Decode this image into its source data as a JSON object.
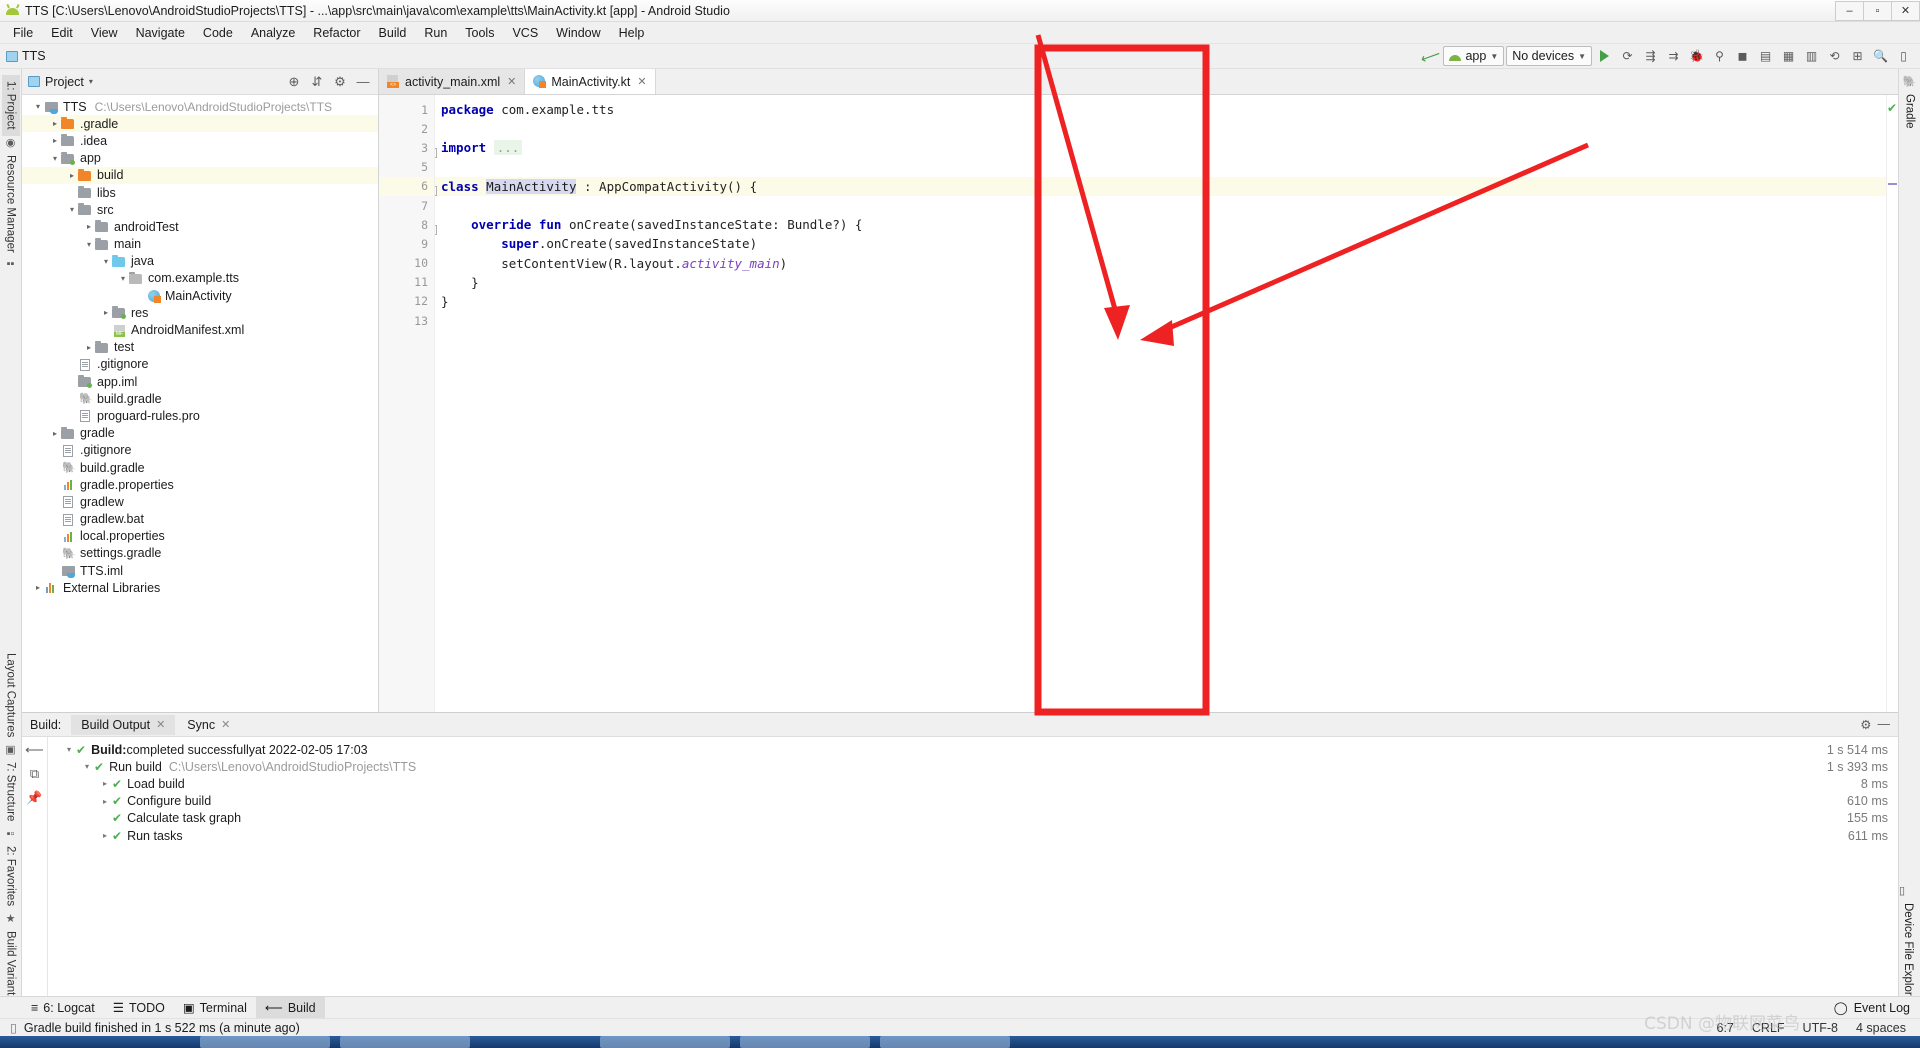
{
  "window": {
    "title": "TTS [C:\\Users\\Lenovo\\AndroidStudioProjects\\TTS] - ...\\app\\src\\main\\java\\com\\example\\tts\\MainActivity.kt [app] - Android Studio",
    "minimize": "–",
    "maximize": "▫",
    "close": "✕"
  },
  "menu": [
    "File",
    "Edit",
    "View",
    "Navigate",
    "Code",
    "Analyze",
    "Refactor",
    "Build",
    "Run",
    "Tools",
    "VCS",
    "Window",
    "Help"
  ],
  "navbar": {
    "breadcrumb": "TTS",
    "run_config": "app",
    "device": "No devices"
  },
  "project_panel": {
    "title": "Project",
    "caret": "▾",
    "tree": [
      {
        "depth": 0,
        "arrow": "▾",
        "icon": "module",
        "label": "TTS",
        "path": "C:\\Users\\Lenovo\\AndroidStudioProjects\\TTS",
        "hl": false
      },
      {
        "depth": 1,
        "arrow": "▸",
        "icon": "folder-orange",
        "label": ".gradle",
        "path": "",
        "hl": true
      },
      {
        "depth": 1,
        "arrow": "▸",
        "icon": "folder",
        "label": ".idea",
        "path": "",
        "hl": false
      },
      {
        "depth": 1,
        "arrow": "▾",
        "icon": "folder-dot",
        "label": "app",
        "path": "",
        "hl": false
      },
      {
        "depth": 2,
        "arrow": "▸",
        "icon": "folder-orange",
        "label": "build",
        "path": "",
        "hl": true
      },
      {
        "depth": 2,
        "arrow": "",
        "icon": "folder",
        "label": "libs",
        "path": "",
        "hl": false
      },
      {
        "depth": 2,
        "arrow": "▾",
        "icon": "folder",
        "label": "src",
        "path": "",
        "hl": false
      },
      {
        "depth": 3,
        "arrow": "▸",
        "icon": "folder",
        "label": "androidTest",
        "path": "",
        "hl": false
      },
      {
        "depth": 3,
        "arrow": "▾",
        "icon": "folder",
        "label": "main",
        "path": "",
        "hl": false
      },
      {
        "depth": 4,
        "arrow": "▾",
        "icon": "folder-blue",
        "label": "java",
        "path": "",
        "hl": false
      },
      {
        "depth": 5,
        "arrow": "▾",
        "icon": "package",
        "label": "com.example.tts",
        "path": "",
        "hl": false
      },
      {
        "depth": 6,
        "arrow": "",
        "icon": "kotlin",
        "label": "MainActivity",
        "path": "",
        "hl": false
      },
      {
        "depth": 4,
        "arrow": "▸",
        "icon": "folder-res",
        "label": "res",
        "path": "",
        "hl": false
      },
      {
        "depth": 4,
        "arrow": "",
        "icon": "manifest",
        "label": "AndroidManifest.xml",
        "path": "",
        "hl": false
      },
      {
        "depth": 3,
        "arrow": "▸",
        "icon": "folder",
        "label": "test",
        "path": "",
        "hl": false
      },
      {
        "depth": 2,
        "arrow": "",
        "icon": "file",
        "label": ".gitignore",
        "path": "",
        "hl": false
      },
      {
        "depth": 2,
        "arrow": "",
        "icon": "folder-dot",
        "label": "app.iml",
        "path": "",
        "hl": false
      },
      {
        "depth": 2,
        "arrow": "",
        "icon": "gradle",
        "label": "build.gradle",
        "path": "",
        "hl": false
      },
      {
        "depth": 2,
        "arrow": "",
        "icon": "file",
        "label": "proguard-rules.pro",
        "path": "",
        "hl": false
      },
      {
        "depth": 1,
        "arrow": "▸",
        "icon": "folder",
        "label": "gradle",
        "path": "",
        "hl": false
      },
      {
        "depth": 1,
        "arrow": "",
        "icon": "file",
        "label": ".gitignore",
        "path": "",
        "hl": false
      },
      {
        "depth": 1,
        "arrow": "",
        "icon": "gradle",
        "label": "build.gradle",
        "path": "",
        "hl": false
      },
      {
        "depth": 1,
        "arrow": "",
        "icon": "props",
        "label": "gradle.properties",
        "path": "",
        "hl": false
      },
      {
        "depth": 1,
        "arrow": "",
        "icon": "file",
        "label": "gradlew",
        "path": "",
        "hl": false
      },
      {
        "depth": 1,
        "arrow": "",
        "icon": "file",
        "label": "gradlew.bat",
        "path": "",
        "hl": false
      },
      {
        "depth": 1,
        "arrow": "",
        "icon": "props",
        "label": "local.properties",
        "path": "",
        "hl": false
      },
      {
        "depth": 1,
        "arrow": "",
        "icon": "gradle",
        "label": "settings.gradle",
        "path": "",
        "hl": false
      },
      {
        "depth": 1,
        "arrow": "",
        "icon": "iml",
        "label": "TTS.iml",
        "path": "",
        "hl": false
      },
      {
        "depth": 0,
        "arrow": "▸",
        "icon": "library",
        "label": "External Libraries",
        "path": "",
        "hl": false
      }
    ]
  },
  "left_rail": {
    "top": [
      "1: Project",
      "Resource Manager"
    ],
    "bottom": [
      "Layout Captures",
      "7: Structure",
      "2: Favorites",
      "Build Variants"
    ]
  },
  "right_rail": {
    "top": "Gradle",
    "bottom": "Device File Explorer"
  },
  "editor": {
    "tabs": [
      {
        "label": "activity_main.xml",
        "icon": "xml-file-icon",
        "active": false,
        "close": "✕"
      },
      {
        "label": "MainActivity.kt",
        "icon": "kotlin-file-icon",
        "active": true,
        "close": "✕"
      }
    ],
    "line_numbers": [
      "1",
      "2",
      "3",
      "5",
      "6",
      "7",
      "8",
      "9",
      "10",
      "11",
      "12",
      "13"
    ],
    "code_lines": [
      {
        "num": "1",
        "hl": false,
        "tokens": [
          {
            "t": "package",
            "c": "kw"
          },
          {
            "t": " com.example.tts",
            "c": "pl"
          }
        ]
      },
      {
        "num": "2",
        "hl": false,
        "tokens": []
      },
      {
        "num": "3",
        "hl": false,
        "fold": "+",
        "tokens": [
          {
            "t": "import",
            "c": "kw"
          },
          {
            "t": " ",
            "c": "pl"
          },
          {
            "t": "...",
            "c": "importbox"
          }
        ]
      },
      {
        "num": "5",
        "hl": false,
        "tokens": []
      },
      {
        "num": "6",
        "hl": true,
        "fold": "−",
        "tokens": [
          {
            "t": "class",
            "c": "kw"
          },
          {
            "t": " ",
            "c": "pl"
          },
          {
            "t": "MainActivity",
            "c": "sel"
          },
          {
            "t": " : AppCompatActivity() {",
            "c": "pl"
          }
        ]
      },
      {
        "num": "7",
        "hl": false,
        "tokens": []
      },
      {
        "num": "8",
        "hl": false,
        "fold": "−",
        "tokens": [
          {
            "t": "    ",
            "c": "pl"
          },
          {
            "t": "override fun",
            "c": "kw"
          },
          {
            "t": " onCreate(savedInstanceState: Bundle?) {",
            "c": "pl"
          }
        ]
      },
      {
        "num": "9",
        "hl": false,
        "tokens": [
          {
            "t": "        ",
            "c": "pl"
          },
          {
            "t": "super",
            "c": "kw"
          },
          {
            "t": ".onCreate(savedInstanceState)",
            "c": "pl"
          }
        ]
      },
      {
        "num": "10",
        "hl": false,
        "tokens": [
          {
            "t": "        setContentView(R.layout.",
            "c": "pl"
          },
          {
            "t": "activity_main",
            "c": "prop"
          },
          {
            "t": ")",
            "c": "pl"
          }
        ]
      },
      {
        "num": "11",
        "hl": false,
        "tokens": [
          {
            "t": "    }",
            "c": "pl"
          }
        ]
      },
      {
        "num": "12",
        "hl": false,
        "tokens": [
          {
            "t": "}",
            "c": "pl"
          }
        ]
      },
      {
        "num": "13",
        "hl": false,
        "tokens": []
      }
    ]
  },
  "build_panel": {
    "label": "Build:",
    "tabs": [
      {
        "label": "Build Output",
        "active": true,
        "close": "✕"
      },
      {
        "label": "Sync",
        "active": false,
        "close": "✕"
      }
    ],
    "rows": [
      {
        "depth": 0,
        "arrow": "▾",
        "bold": "Build:",
        "text": " completed successfully",
        "suffix": " at 2022-02-05 17:03",
        "path": "",
        "time": "1 s 514 ms"
      },
      {
        "depth": 1,
        "arrow": "▾",
        "bold": "",
        "text": "Run build",
        "suffix": "",
        "path": "C:\\Users\\Lenovo\\AndroidStudioProjects\\TTS",
        "time": "1 s 393 ms"
      },
      {
        "depth": 2,
        "arrow": "▸",
        "bold": "",
        "text": "Load build",
        "suffix": "",
        "path": "",
        "time": "8 ms"
      },
      {
        "depth": 2,
        "arrow": "▸",
        "bold": "",
        "text": "Configure build",
        "suffix": "",
        "path": "",
        "time": "610 ms"
      },
      {
        "depth": 2,
        "arrow": "",
        "bold": "",
        "text": "Calculate task graph",
        "suffix": "",
        "path": "",
        "time": "155 ms"
      },
      {
        "depth": 2,
        "arrow": "▸",
        "bold": "",
        "text": "Run tasks",
        "suffix": "",
        "path": "",
        "time": "611 ms"
      }
    ]
  },
  "bottom_toolwindows": [
    {
      "label": "6: Logcat",
      "icon": "logcat-icon",
      "active": false
    },
    {
      "label": "TODO",
      "icon": "todo-icon",
      "active": false
    },
    {
      "label": "Terminal",
      "icon": "terminal-icon",
      "active": false
    },
    {
      "label": "Build",
      "icon": "build-hammer-icon",
      "active": true
    }
  ],
  "status": {
    "message": "Gradle build finished in 1 s 522 ms (a minute ago)",
    "event_log": "Event Log",
    "caret": "6:7",
    "line_separator": "CRLF",
    "encoding": "UTF-8",
    "indent": "4 spaces",
    "watermark": "CSDN @物联网菜鸟"
  },
  "annotation": {
    "rect_color": "#ee2222",
    "arrow_color": "#ee2222"
  }
}
